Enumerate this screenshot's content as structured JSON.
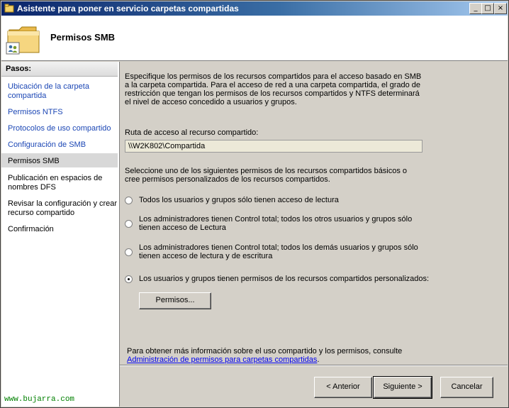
{
  "window": {
    "title": "Asistente para poner en servicio carpetas compartidas",
    "minimize_glyph": "_",
    "maximize_glyph": "□",
    "close_glyph": "×"
  },
  "header": {
    "title": "Permisos SMB",
    "icon": "shared-folder-icon"
  },
  "sidebar": {
    "heading": "Pasos:",
    "items": [
      {
        "label": "Ubicación de la carpeta compartida",
        "state": "link"
      },
      {
        "label": "Permisos NTFS",
        "state": "link"
      },
      {
        "label": "Protocolos de uso compartido",
        "state": "link"
      },
      {
        "label": "Configuración de SMB",
        "state": "link"
      },
      {
        "label": "Permisos SMB",
        "state": "current"
      },
      {
        "label": "Publicación en espacios de nombres DFS",
        "state": "pending"
      },
      {
        "label": "Revisar la configuración y crear recurso compartido",
        "state": "pending"
      },
      {
        "label": "Confirmación",
        "state": "pending"
      }
    ],
    "watermark": "www.bujarra.com"
  },
  "main": {
    "intro": "Especifique los permisos de los recursos compartidos para el acceso basado en SMB a la carpeta compartida. Para el acceso de red a una carpeta compartida, el grado de restricción que tengan los permisos de los recursos compartidos y NTFS determinará el nivel de acceso concedido a usuarios y grupos.",
    "path_label": "Ruta de acceso al recurso compartido:",
    "path_value": "\\\\W2K802\\Compartida",
    "choose_text": "Seleccione uno de los siguientes permisos de los recursos compartidos básicos o cree permisos personalizados de los recursos compartidos.",
    "options": [
      {
        "label": "Todos los usuarios y grupos sólo tienen acceso de lectura",
        "checked": false
      },
      {
        "label": "Los administradores tienen Control total; todos los otros usuarios y grupos sólo tienen acceso de Lectura",
        "checked": false
      },
      {
        "label": "Los administradores tienen Control total; todos los demás usuarios y grupos sólo tienen acceso de lectura y de escritura",
        "checked": false
      },
      {
        "label": "Los usuarios y grupos tienen permisos de los recursos compartidos personalizados:",
        "checked": true
      }
    ],
    "permissions_button": "Permisos...",
    "info_text": "Para obtener más información sobre el uso compartido y los permisos, consulte",
    "info_link": "Administración de permisos para carpetas compartidas",
    "info_link_suffix": "."
  },
  "footer": {
    "back_label": "< Anterior",
    "next_label": "Siguiente >",
    "cancel_label": "Cancelar"
  },
  "colors": {
    "titlebar_start": "#0a246a",
    "link": "#1c47b5",
    "watermark": "#008000"
  }
}
